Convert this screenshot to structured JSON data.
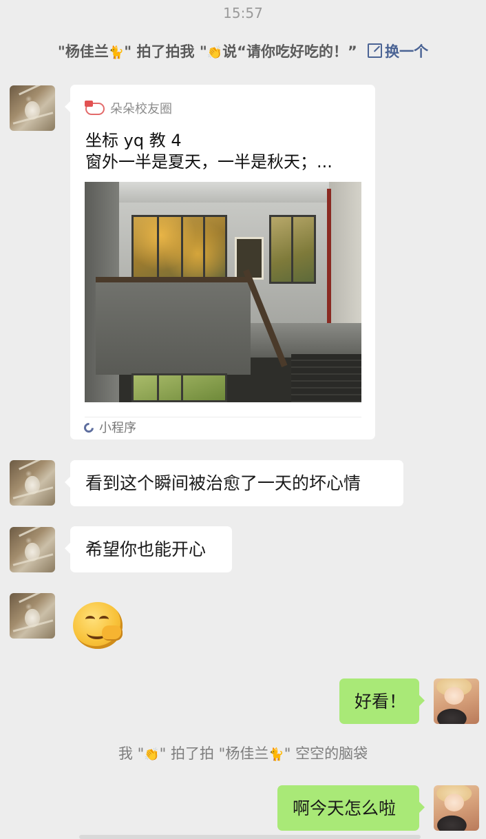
{
  "chat": {
    "timestamp": "15:57",
    "pat_top": {
      "prefix": "\"杨佳兰",
      "mid": "\" 拍了拍我 \"",
      "suffix": "说“请你吃好吃的！”",
      "action_label": "换一个"
    },
    "card": {
      "source_name": "朵朵校友圈",
      "title_line1": "坐标 yq 教 4",
      "title_line2": "窗外一半是夏天，一半是秋天；...",
      "footer_label": "小程序"
    },
    "messages_left": [
      "看到这个瞬间被治愈了一天的坏心情",
      "希望你也能开心"
    ],
    "message_right_1": "好看！",
    "pat_bottom": {
      "prefix": "我 \"",
      "mid": "\" 拍了拍 \"杨佳兰",
      "suffix": "\" 空空的脑袋"
    },
    "message_right_2": "啊今天怎么啦"
  },
  "icons": {
    "card_source": "duoduo-logo-icon",
    "mini_program": "mini-program-icon",
    "edit": "edit-icon",
    "emoji": "sly-smile-emoji"
  },
  "colors": {
    "background": "#ededed",
    "bubble_self": "#a9e977",
    "bubble_other": "#ffffff",
    "link": "#4a6394"
  }
}
